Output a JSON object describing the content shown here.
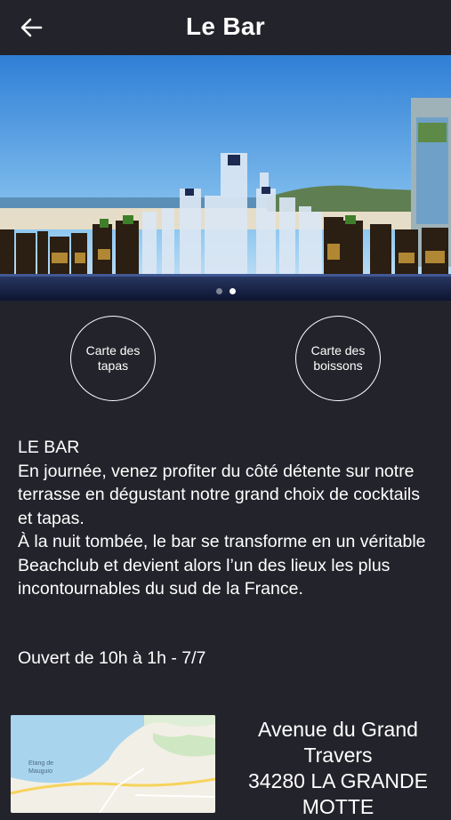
{
  "header": {
    "title": "Le Bar",
    "back_icon": "arrow-left-icon"
  },
  "carousel": {
    "slide_count": 2,
    "active_index": 1
  },
  "buttons": {
    "tapas": "Carte des tapas",
    "boissons": "Carte des boissons"
  },
  "description": {
    "heading": "LE BAR",
    "paragraph1": "En journée, venez profiter du côté détente sur notre terrasse en dégustant notre grand choix de cocktails et tapas.",
    "paragraph2": "À la nuit tombée, le bar se transforme en un véritable Beachclub et devient alors l’un des lieux les plus incontournables du sud de la France."
  },
  "hours": "Ouvert de 10h à 1h - 7/7",
  "map": {
    "label_line1": "Etang de",
    "label_line2": "Mauguio"
  },
  "address": {
    "line1": "Avenue du Grand",
    "line2": "Travers",
    "line3": "34280 LA GRANDE",
    "line4": "MOTTE"
  },
  "colors": {
    "background": "#23232b",
    "text": "#ffffff"
  }
}
